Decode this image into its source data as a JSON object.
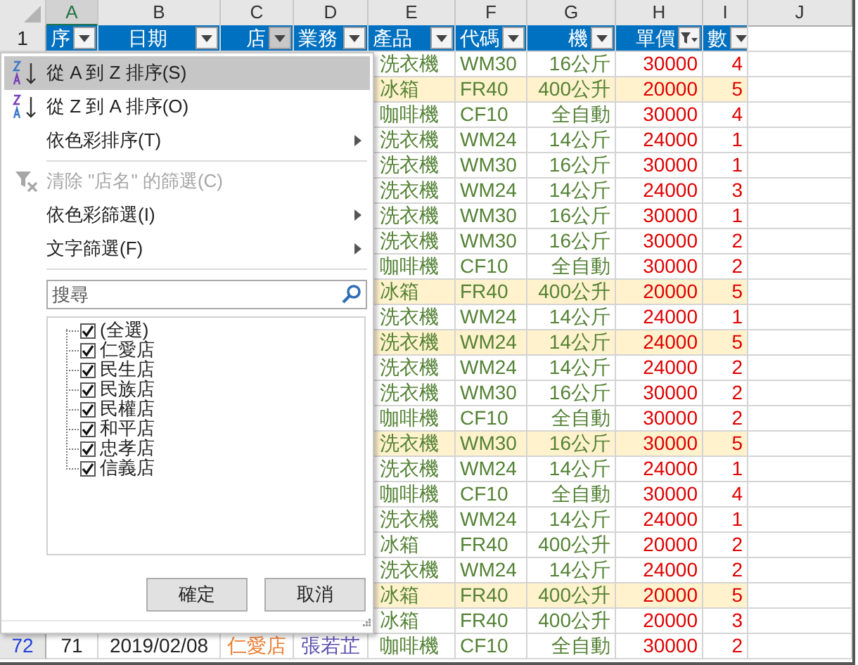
{
  "column_headers": [
    {
      "label": "A",
      "selected": true
    },
    {
      "label": "B",
      "selected": false
    },
    {
      "label": "C",
      "selected": false
    },
    {
      "label": "D",
      "selected": false
    },
    {
      "label": "E",
      "selected": false
    },
    {
      "label": "F",
      "selected": false
    },
    {
      "label": "G",
      "selected": false
    },
    {
      "label": "H",
      "selected": false
    },
    {
      "label": "I",
      "selected": false
    },
    {
      "label": "J",
      "selected": false
    }
  ],
  "header_row": {
    "row_number": "1",
    "cells": [
      {
        "label": "序",
        "open": false,
        "filtered": false
      },
      {
        "label": "日期",
        "open": false,
        "filtered": false
      },
      {
        "label": "店",
        "open": true,
        "filtered": false
      },
      {
        "label": "業務",
        "open": false,
        "filtered": false
      },
      {
        "label": "產品",
        "open": false,
        "filtered": false
      },
      {
        "label": "代碼",
        "open": false,
        "filtered": false
      },
      {
        "label": "機",
        "open": false,
        "filtered": false
      },
      {
        "label": "單價",
        "open": false,
        "filtered": true
      },
      {
        "label": "數",
        "open": false,
        "filtered": false
      }
    ]
  },
  "rows": [
    {
      "product": "洗衣機",
      "code": "WM30",
      "spec": "16公斤",
      "price": "30000",
      "qty": "4",
      "highlighted": false
    },
    {
      "product": "冰箱",
      "code": "FR40",
      "spec": "400公升",
      "price": "20000",
      "qty": "5",
      "highlighted": true
    },
    {
      "product": "咖啡機",
      "code": "CF10",
      "spec": "全自動",
      "price": "30000",
      "qty": "4",
      "highlighted": false
    },
    {
      "product": "洗衣機",
      "code": "WM24",
      "spec": "14公斤",
      "price": "24000",
      "qty": "1",
      "highlighted": false
    },
    {
      "product": "洗衣機",
      "code": "WM30",
      "spec": "16公斤",
      "price": "30000",
      "qty": "1",
      "highlighted": false
    },
    {
      "product": "洗衣機",
      "code": "WM24",
      "spec": "14公斤",
      "price": "24000",
      "qty": "3",
      "highlighted": false
    },
    {
      "product": "洗衣機",
      "code": "WM30",
      "spec": "16公斤",
      "price": "30000",
      "qty": "1",
      "highlighted": false
    },
    {
      "product": "洗衣機",
      "code": "WM30",
      "spec": "16公斤",
      "price": "30000",
      "qty": "2",
      "highlighted": false
    },
    {
      "product": "咖啡機",
      "code": "CF10",
      "spec": "全自動",
      "price": "30000",
      "qty": "2",
      "highlighted": false
    },
    {
      "product": "冰箱",
      "code": "FR40",
      "spec": "400公升",
      "price": "20000",
      "qty": "5",
      "highlighted": true
    },
    {
      "product": "洗衣機",
      "code": "WM24",
      "spec": "14公斤",
      "price": "24000",
      "qty": "1",
      "highlighted": false
    },
    {
      "product": "洗衣機",
      "code": "WM24",
      "spec": "14公斤",
      "price": "24000",
      "qty": "5",
      "highlighted": true
    },
    {
      "product": "洗衣機",
      "code": "WM24",
      "spec": "14公斤",
      "price": "24000",
      "qty": "2",
      "highlighted": false
    },
    {
      "product": "洗衣機",
      "code": "WM30",
      "spec": "16公斤",
      "price": "30000",
      "qty": "2",
      "highlighted": false
    },
    {
      "product": "咖啡機",
      "code": "CF10",
      "spec": "全自動",
      "price": "30000",
      "qty": "2",
      "highlighted": false
    },
    {
      "product": "洗衣機",
      "code": "WM30",
      "spec": "16公斤",
      "price": "30000",
      "qty": "5",
      "highlighted": true
    },
    {
      "product": "洗衣機",
      "code": "WM24",
      "spec": "14公斤",
      "price": "24000",
      "qty": "1",
      "highlighted": false
    },
    {
      "product": "咖啡機",
      "code": "CF10",
      "spec": "全自動",
      "price": "30000",
      "qty": "4",
      "highlighted": false
    },
    {
      "product": "洗衣機",
      "code": "WM24",
      "spec": "14公斤",
      "price": "24000",
      "qty": "1",
      "highlighted": false
    },
    {
      "product": "冰箱",
      "code": "FR40",
      "spec": "400公升",
      "price": "20000",
      "qty": "2",
      "highlighted": false
    },
    {
      "product": "洗衣機",
      "code": "WM24",
      "spec": "14公斤",
      "price": "24000",
      "qty": "2",
      "highlighted": false
    },
    {
      "product": "冰箱",
      "code": "FR40",
      "spec": "400公升",
      "price": "20000",
      "qty": "5",
      "highlighted": true
    },
    {
      "product": "冰箱",
      "code": "FR40",
      "spec": "400公升",
      "price": "20000",
      "qty": "3",
      "highlighted": false
    },
    {
      "row_number": "72",
      "seq": "71",
      "date": "2019/02/08",
      "store": "仁愛店",
      "staff": "張若芷",
      "product": "咖啡機",
      "code": "CF10",
      "spec": "全自動",
      "price": "30000",
      "qty": "2",
      "highlighted": false
    }
  ],
  "filter_menu": {
    "items": [
      {
        "kind": "sort_ascending",
        "label": "從 A 到 Z 排序(S)",
        "highlighted": true,
        "disabled": false,
        "submenu": false
      },
      {
        "kind": "sort_descending",
        "label": "從 Z 到 A 排序(O)",
        "highlighted": false,
        "disabled": false,
        "submenu": false
      },
      {
        "kind": "plain",
        "label": "依色彩排序(T)",
        "highlighted": false,
        "disabled": false,
        "submenu": true
      },
      {
        "kind": "separator"
      },
      {
        "kind": "clear_filter",
        "label": "清除 \"店名\" 的篩選(C)",
        "highlighted": false,
        "disabled": true,
        "submenu": false
      },
      {
        "kind": "plain",
        "label": "依色彩篩選(I)",
        "highlighted": false,
        "disabled": false,
        "submenu": true
      },
      {
        "kind": "plain",
        "label": "文字篩選(F)",
        "highlighted": false,
        "disabled": false,
        "submenu": true
      },
      {
        "kind": "separator"
      }
    ],
    "search": {
      "placeholder": "搜尋"
    },
    "values": [
      {
        "label": "(全選)",
        "checked": true
      },
      {
        "label": "仁愛店",
        "checked": true
      },
      {
        "label": "民生店",
        "checked": true
      },
      {
        "label": "民族店",
        "checked": true
      },
      {
        "label": "民權店",
        "checked": true
      },
      {
        "label": "和平店",
        "checked": true
      },
      {
        "label": "忠孝店",
        "checked": true
      },
      {
        "label": "信義店",
        "checked": true
      }
    ],
    "buttons": [
      {
        "label": "確定"
      },
      {
        "label": "取消"
      }
    ]
  }
}
